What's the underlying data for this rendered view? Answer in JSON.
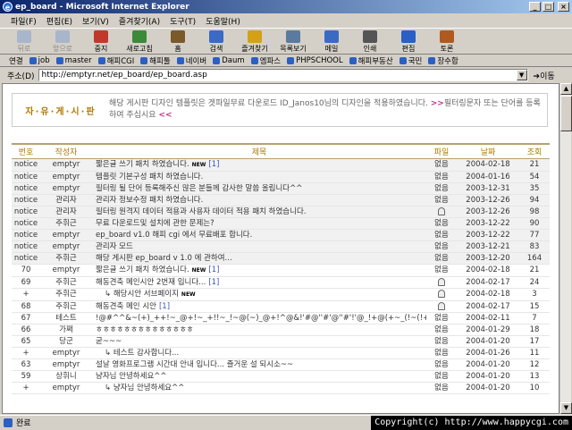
{
  "window": {
    "title": "ep_board - Microsoft Internet Explorer"
  },
  "menu": [
    "파일(F)",
    "편집(E)",
    "보기(V)",
    "즐겨찾기(A)",
    "도구(T)",
    "도움말(H)"
  ],
  "toolbar": [
    {
      "label": "뒤로",
      "icon": "back-icon",
      "disabled": true
    },
    {
      "label": "앞으로",
      "icon": "forward-icon",
      "disabled": true
    },
    {
      "label": "중지",
      "icon": "stop-icon"
    },
    {
      "label": "새로고침",
      "icon": "refresh-icon"
    },
    {
      "label": "홈",
      "icon": "home-icon"
    },
    {
      "label": "검색",
      "icon": "search-icon"
    },
    {
      "label": "즐겨찾기",
      "icon": "favorites-icon"
    },
    {
      "label": "목록보기",
      "icon": "history-icon"
    },
    {
      "label": "메일",
      "icon": "mail-icon"
    },
    {
      "label": "인쇄",
      "icon": "print-icon"
    },
    {
      "label": "편집",
      "icon": "edit-icon"
    },
    {
      "label": "토론",
      "icon": "discuss-icon"
    }
  ],
  "links": {
    "label": "연결",
    "items": [
      "job",
      "master",
      "해피CGI",
      "해피툴",
      "네이버",
      "Daum",
      "엠파스",
      "PHPSCHOOL",
      "해피부동산",
      "국민",
      "장수합"
    ]
  },
  "address": {
    "label": "주소(D)",
    "url": "http://emptyr.net/ep_board/ep_board.asp",
    "go": "이동"
  },
  "notice": {
    "label": "자·유·게·시·판",
    "text": "해당 게시판 디자인 템플릿은 겟파일무료 다운로드 ID_Janos10님의 디자인을 적용하였습니다.",
    "marker_open": ">>",
    "link_text": "필터링문자 또는 단어를 등록하여 주십시요",
    "marker_close": "<<"
  },
  "board": {
    "headers": [
      "번호",
      "작성자",
      "제목",
      "파일",
      "날짜",
      "조회"
    ],
    "rows": [
      {
        "no": "notice",
        "author": "emptyr",
        "title": "짧은글 쓰기 패치 하였습니다.",
        "new": "NEW",
        "comments": "[1]",
        "file": "없음",
        "date": "2004-02-18",
        "views": "21",
        "notice": true
      },
      {
        "no": "notice",
        "author": "emptyr",
        "title": "템플릿 기본구성 패치 하였습니다.",
        "file": "없음",
        "date": "2004-01-16",
        "views": "54",
        "notice": true
      },
      {
        "no": "notice",
        "author": "emptyr",
        "title": "필터링 될 단어 등록해주신 많은 분들께 감사한 말씀 올립니다^^",
        "file": "없음",
        "date": "2003-12-31",
        "views": "35",
        "notice": true
      },
      {
        "no": "notice",
        "author": "관리자",
        "title": "관리자 정보수정 패치 하였습니다.",
        "file": "없음",
        "date": "2003-12-26",
        "views": "94",
        "notice": true
      },
      {
        "no": "notice",
        "author": "관리자",
        "title": "필터링 원격지 데이터 적용과 사용자 데이터 적용 패치 하였습니다.",
        "file": "icon",
        "date": "2003-12-26",
        "views": "98",
        "notice": true
      },
      {
        "no": "notice",
        "author": "주휘근",
        "title": "무료 다운로드및 설치에 관한 문제는?",
        "file": "없음",
        "date": "2003-12-22",
        "views": "90",
        "notice": true
      },
      {
        "no": "notice",
        "author": "emptyr",
        "title": "ep_board v1.0 해피 cgi 에서 무료배포 합니다.",
        "file": "없음",
        "date": "2003-12-22",
        "views": "77",
        "notice": true
      },
      {
        "no": "notice",
        "author": "emptyr",
        "title": "관리자 모드",
        "file": "없음",
        "date": "2003-12-21",
        "views": "83",
        "notice": true
      },
      {
        "no": "notice",
        "author": "주휘근",
        "title": "해당 게시판 ep_board v 1.0 에 관하여...",
        "file": "없음",
        "date": "2003-12-20",
        "views": "164",
        "notice": true
      },
      {
        "no": "70",
        "author": "emptyr",
        "title": "짧은글 쓰기 패치 하였습니다.",
        "new": "NEW",
        "comments": "[1]",
        "file": "없음",
        "date": "2004-02-18",
        "views": "21"
      },
      {
        "no": "69",
        "author": "주휘근",
        "title": "해동견축 메인시안 2번재 입니다...",
        "comments": "[1]",
        "file": "icon",
        "date": "2004-02-17",
        "views": "24"
      },
      {
        "no": "+",
        "author": "주휘근",
        "title": "↳ 해당시안 서브페이지",
        "new": "NEW",
        "file": "icon",
        "date": "2004-02-18",
        "views": "3"
      },
      {
        "no": "68",
        "author": "주휘근",
        "title": "해동견축 메인 시안",
        "comments": "[1]",
        "file": "icon",
        "date": "2004-02-17",
        "views": "15"
      },
      {
        "no": "67",
        "author": "테스트",
        "title": "!@#^^&~(+)_++!~_@+!~_+!!~_!~@(~)_@+!^@&!'#@''#'@''#'!'@_!+@(+~_(!~(!+#!^^#'^&@''^@~'!'~'!#^~'!'~'!@",
        "file": "없음",
        "date": "2004-02-11",
        "views": "7"
      },
      {
        "no": "66",
        "author": "가쩌",
        "title": "ㅎㅎㅎㅎㅎㅎㅎㅎㅎㅎㅎㅎㅎㅎ",
        "file": "없음",
        "date": "2004-01-29",
        "views": "18"
      },
      {
        "no": "65",
        "author": "당군",
        "title": "굳~~~",
        "file": "없음",
        "date": "2004-01-20",
        "views": "17"
      },
      {
        "no": "+",
        "author": "emptyr",
        "title": "↳ 테스트 감사합니다...",
        "file": "없음",
        "date": "2004-01-26",
        "views": "11"
      },
      {
        "no": "63",
        "author": "emptyr",
        "title": "설날 영화프로그램 시간대 안내 입니다... 즐거운 설 되시소~~",
        "file": "없음",
        "date": "2004-01-20",
        "views": "12"
      },
      {
        "no": "59",
        "author": "상휘니",
        "title": "냥자님 안녕하세요^^",
        "file": "없음",
        "date": "2004-01-20",
        "views": "13"
      },
      {
        "no": "+",
        "author": "emptyr",
        "title": "↳ 냥자님 안녕하세요^^",
        "file": "없음",
        "date": "2004-01-20",
        "views": "10"
      }
    ]
  },
  "status": {
    "text": "완료",
    "copyright": "Copyright(c) http://www.happycgi.com"
  }
}
